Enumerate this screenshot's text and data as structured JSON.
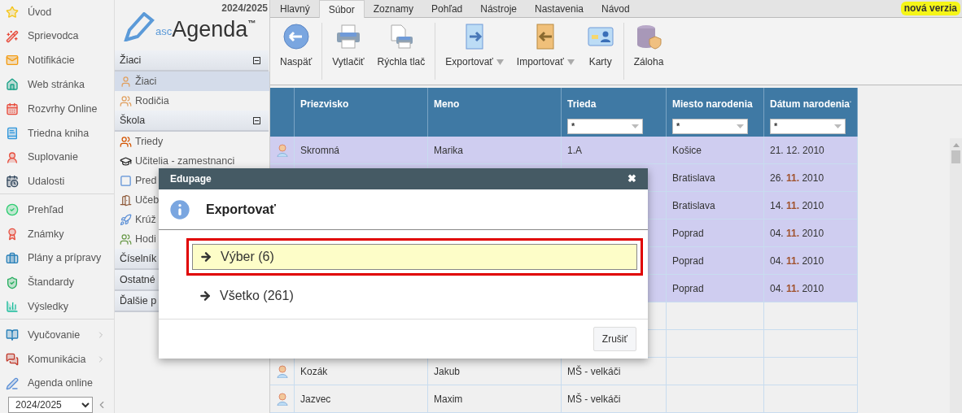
{
  "main_menu": [
    {
      "items": [
        {
          "label": "Úvod",
          "submenu": false
        },
        {
          "label": "Sprievodca",
          "submenu": false
        },
        {
          "label": "Notifikácie",
          "submenu": false
        },
        {
          "label": "Web stránka",
          "submenu": false
        },
        {
          "label": "Rozvrhy Online",
          "submenu": false
        },
        {
          "label": "Triedna kniha",
          "submenu": false
        },
        {
          "label": "Suplovanie",
          "submenu": false
        },
        {
          "label": "Udalosti",
          "submenu": false
        }
      ]
    },
    {
      "items": [
        {
          "label": "Prehľad",
          "submenu": false
        },
        {
          "label": "Známky",
          "submenu": false
        },
        {
          "label": "Plány a prípravy",
          "submenu": false
        },
        {
          "label": "Štandardy",
          "submenu": false
        },
        {
          "label": "Výsledky",
          "submenu": false
        }
      ]
    },
    {
      "items": [
        {
          "label": "Vyučovanie",
          "submenu": true
        },
        {
          "label": "Komunikácia",
          "submenu": true
        },
        {
          "label": "Agenda online",
          "submenu": false
        }
      ]
    }
  ],
  "year_select": {
    "value": "2024/2025"
  },
  "logo": {
    "year": "2024/2025",
    "prefix": "asc",
    "name": "Agenda",
    "mark": "™"
  },
  "modules": [
    {
      "label": "Žiaci",
      "expanded": true,
      "items": [
        {
          "label": "Žiaci",
          "selected": true
        },
        {
          "label": "Rodičia",
          "selected": false
        }
      ]
    },
    {
      "label": "Škola",
      "expanded": true,
      "items": [
        {
          "label": "Triedy",
          "selected": false
        },
        {
          "label": "Učitelia - zamestnanci",
          "selected": false
        },
        {
          "label": "Pred",
          "selected": false
        },
        {
          "label": "Učeb",
          "selected": false
        },
        {
          "label": "Krúž",
          "selected": false
        },
        {
          "label": "Hodi",
          "selected": false
        }
      ]
    },
    {
      "label": "Číselník"
    },
    {
      "label": "Ostatné"
    },
    {
      "label": "Ďalšie p"
    }
  ],
  "tabs": [
    {
      "label": "Hlavný",
      "selected": false
    },
    {
      "label": "Súbor",
      "selected": true
    },
    {
      "label": "Zoznamy",
      "selected": false
    },
    {
      "label": "Pohľad",
      "selected": false
    },
    {
      "label": "Nástroje",
      "selected": false
    },
    {
      "label": "Nastavenia",
      "selected": false
    },
    {
      "label": "Návod",
      "selected": false
    }
  ],
  "new_version": "nová verzia",
  "ribbon": [
    [
      {
        "label": "Naspäť",
        "dropdown": false
      }
    ],
    [
      {
        "label": "Vytlačiť",
        "dropdown": false
      },
      {
        "label": "Rýchla tlač",
        "dropdown": false
      }
    ],
    [
      {
        "label": "Exportovať",
        "dropdown": true
      },
      {
        "label": "Importovať",
        "dropdown": true
      },
      {
        "label": "Karty",
        "dropdown": false
      }
    ],
    [
      {
        "label": "Záloha",
        "dropdown": false
      }
    ]
  ],
  "table": {
    "columns": [
      {
        "label": "Priezvisko",
        "sorted": false
      },
      {
        "label": "Meno",
        "sorted": false
      },
      {
        "label": "Trieda",
        "filter": "*",
        "sorted": false
      },
      {
        "label": "Miesto narodenia",
        "filter": "*",
        "sorted": false
      },
      {
        "label": "Dátum narodenia",
        "filter": "*",
        "sorted": true
      }
    ],
    "rows": [
      {
        "selected": true,
        "icon": true,
        "surname": "Skromná",
        "name": "Marika",
        "class": "1.A",
        "place": "Košice",
        "date": [
          "21.",
          "12.",
          "2010"
        ],
        "month_highlighted": false
      },
      {
        "selected": true,
        "place": "Bratislava",
        "date": [
          "26.",
          "11.",
          "2010"
        ],
        "month_highlighted": true
      },
      {
        "selected": true,
        "place": "Bratislava",
        "date": [
          "14.",
          "11.",
          "2010"
        ],
        "month_highlighted": true
      },
      {
        "selected": true,
        "place": "Poprad",
        "date": [
          "04.",
          "11.",
          "2010"
        ],
        "month_highlighted": true
      },
      {
        "selected": true,
        "place": "Poprad",
        "date": [
          "04.",
          "11.",
          "2010"
        ],
        "month_highlighted": true
      },
      {
        "selected": true,
        "place": "Poprad",
        "date": [
          "04.",
          "11.",
          "2010"
        ],
        "month_highlighted": true
      },
      {
        "selected": false
      },
      {
        "selected": false
      },
      {
        "selected": false,
        "icon": true,
        "surname": "Kozák",
        "name": "Jakub",
        "class": "MŠ - velkáči"
      },
      {
        "selected": false,
        "icon": true,
        "surname": "Jazvec",
        "name": "Maxim",
        "class": "MŠ - velkáči"
      }
    ]
  },
  "dialog": {
    "title": "Edupage",
    "close": "✖",
    "heading": "Exportovať",
    "options": [
      {
        "label": "Výber (6)",
        "selected": true
      },
      {
        "label": "Všetko (261)",
        "selected": false
      }
    ],
    "cancel": "Zrušiť"
  }
}
